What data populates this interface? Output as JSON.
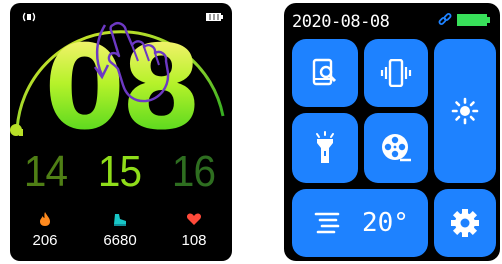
{
  "watch_face_1": {
    "hour": "08",
    "dates": [
      "14",
      "15",
      "16"
    ],
    "stats": [
      {
        "icon": "flame-icon",
        "value": "206"
      },
      {
        "icon": "shoe-icon",
        "value": "6680"
      },
      {
        "icon": "heart-icon",
        "value": "108"
      }
    ],
    "colors": {
      "arc_start": "#d9e72a",
      "arc_end": "#1fa31f",
      "hour_top": "#fff27a",
      "hour_bottom": "#3ed11b"
    }
  },
  "watch_face_2": {
    "date": "2020-08-08",
    "temperature": "20°",
    "tiles": [
      {
        "icon": "find-phone-icon"
      },
      {
        "icon": "vibrate-icon"
      },
      {
        "icon": "brightness-icon"
      },
      {
        "icon": "flashlight-icon"
      },
      {
        "icon": "film-reel-icon"
      },
      {
        "icon": "weather-wind-icon"
      },
      {
        "icon": "gear-icon"
      }
    ],
    "colors": {
      "tile": "#1e82ff",
      "battery": "#38e05a",
      "link": "#1e82ff"
    }
  }
}
